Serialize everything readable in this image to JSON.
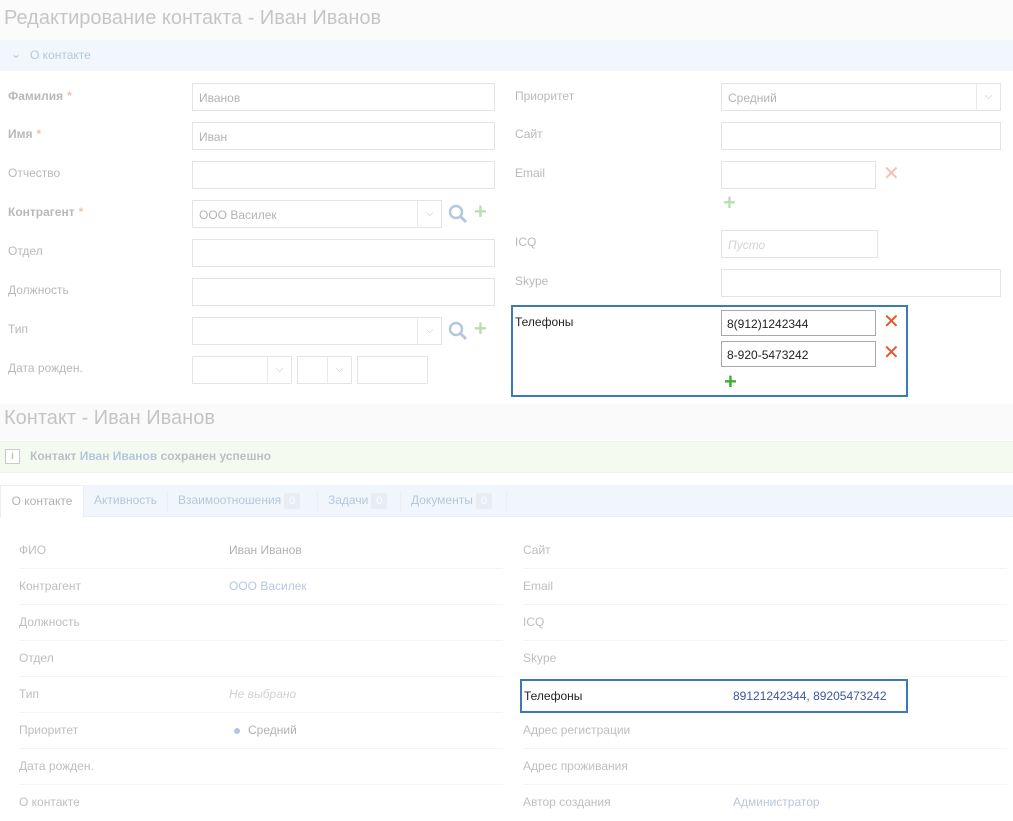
{
  "edit": {
    "title": "Редактирование контакта - Иван Иванов",
    "section_label": "О контакте",
    "fields": {
      "last_name": {
        "label": "Фамилия",
        "value": "Иванов"
      },
      "first_name": {
        "label": "Имя",
        "value": "Иван"
      },
      "middle_name": {
        "label": "Отчество",
        "value": ""
      },
      "counterparty": {
        "label": "Контрагент",
        "value": "ООО Василек"
      },
      "department": {
        "label": "Отдел",
        "value": ""
      },
      "position": {
        "label": "Должность",
        "value": ""
      },
      "type": {
        "label": "Тип",
        "value": ""
      },
      "birthdate": {
        "label": "Дата рожден.",
        "value": ""
      },
      "priority": {
        "label": "Приоритет",
        "value": "Средний"
      },
      "site": {
        "label": "Сайт",
        "value": ""
      },
      "email": {
        "label": "Email",
        "value": ""
      },
      "icq": {
        "label": "ICQ",
        "placeholder": "Пусто"
      },
      "skype": {
        "label": "Skype",
        "value": ""
      },
      "phones": {
        "label": "Телефоны",
        "values": [
          "8(912)1242344",
          "8-920-5473242"
        ]
      }
    }
  },
  "view": {
    "title": "Контакт - Иван Иванов",
    "alert": {
      "prefix": "Контакт",
      "name": "Иван Иванов",
      "suffix": "сохранен успешно"
    },
    "tabs": [
      {
        "label": "О контакте",
        "count": null
      },
      {
        "label": "Активность",
        "count": null
      },
      {
        "label": "Взаимоотношения",
        "count": "0"
      },
      {
        "label": "Задачи",
        "count": "0"
      },
      {
        "label": "Документы",
        "count": "0"
      }
    ],
    "left_rows": [
      {
        "label": "ФИО",
        "value": "Иван Иванов"
      },
      {
        "label": "Контрагент",
        "value": "ООО Василек"
      },
      {
        "label": "Должность",
        "value": ""
      },
      {
        "label": "Отдел",
        "value": ""
      },
      {
        "label": "Тип",
        "value": "Не выбрано"
      },
      {
        "label": "Приоритет",
        "value": "Средний"
      },
      {
        "label": "Дата рожден.",
        "value": ""
      },
      {
        "label": "О контакте",
        "value": ""
      }
    ],
    "right_rows": [
      {
        "label": "Сайт",
        "value": ""
      },
      {
        "label": "Email",
        "value": ""
      },
      {
        "label": "ICQ",
        "value": ""
      },
      {
        "label": "Skype",
        "value": ""
      },
      {
        "label": "Телефоны",
        "value": "89121242344, 89205473242"
      },
      {
        "label": "Адрес регистрации",
        "value": ""
      },
      {
        "label": "Адрес проживания",
        "value": ""
      },
      {
        "label": "Автор создания",
        "value": "Администратор"
      }
    ]
  },
  "colors": {
    "accent": "#3a6ea5",
    "highlight_border": "#3a7ab8",
    "success_bg": "#e6f4dd",
    "remove": "#e2582a",
    "add": "#44aa33"
  }
}
